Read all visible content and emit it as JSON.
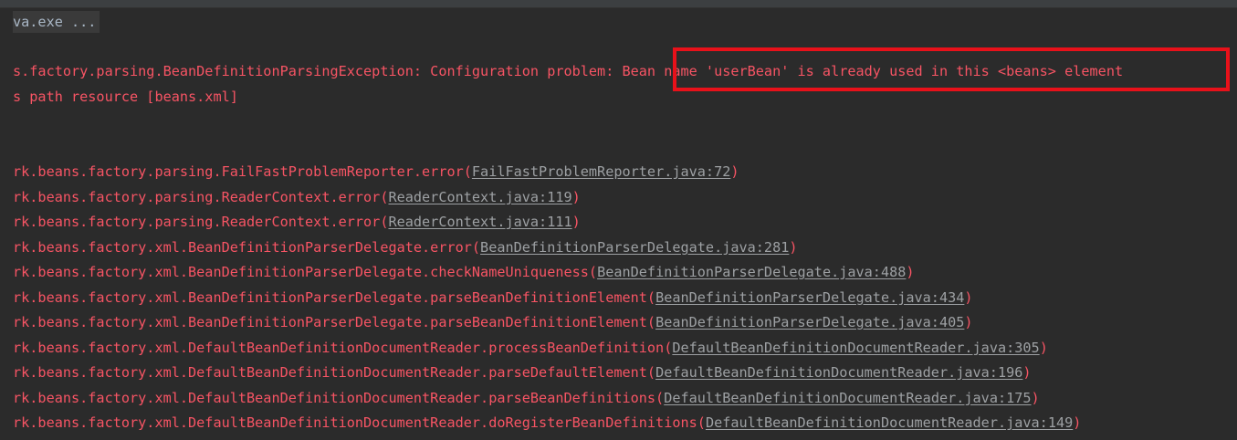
{
  "console": {
    "command_line": "va.exe ...",
    "exception_line": "s.factory.parsing.BeanDefinitionParsingException: Configuration problem: Bean name 'userBean' is already used in this <beans> element",
    "resource_line": "s path resource [beans.xml]",
    "stack_frames": [
      {
        "method": "rk.beans.factory.parsing.FailFastProblemReporter.error(",
        "link": "FailFastProblemReporter.java:72",
        "close": ")"
      },
      {
        "method": "rk.beans.factory.parsing.ReaderContext.error(",
        "link": "ReaderContext.java:119",
        "close": ")"
      },
      {
        "method": "rk.beans.factory.parsing.ReaderContext.error(",
        "link": "ReaderContext.java:111",
        "close": ")"
      },
      {
        "method": "rk.beans.factory.xml.BeanDefinitionParserDelegate.error(",
        "link": "BeanDefinitionParserDelegate.java:281",
        "close": ")"
      },
      {
        "method": "rk.beans.factory.xml.BeanDefinitionParserDelegate.checkNameUniqueness(",
        "link": "BeanDefinitionParserDelegate.java:488",
        "close": ")"
      },
      {
        "method": "rk.beans.factory.xml.BeanDefinitionParserDelegate.parseBeanDefinitionElement(",
        "link": "BeanDefinitionParserDelegate.java:434",
        "close": ")"
      },
      {
        "method": "rk.beans.factory.xml.BeanDefinitionParserDelegate.parseBeanDefinitionElement(",
        "link": "BeanDefinitionParserDelegate.java:405",
        "close": ")"
      },
      {
        "method": "rk.beans.factory.xml.DefaultBeanDefinitionDocumentReader.processBeanDefinition(",
        "link": "DefaultBeanDefinitionDocumentReader.java:305",
        "close": ")"
      },
      {
        "method": "rk.beans.factory.xml.DefaultBeanDefinitionDocumentReader.parseDefaultElement(",
        "link": "DefaultBeanDefinitionDocumentReader.java:196",
        "close": ")"
      },
      {
        "method": "rk.beans.factory.xml.DefaultBeanDefinitionDocumentReader.parseBeanDefinitions(",
        "link": "DefaultBeanDefinitionDocumentReader.java:175",
        "close": ")"
      },
      {
        "method": "rk.beans.factory.xml.DefaultBeanDefinitionDocumentReader.doRegisterBeanDefinitions(",
        "link": "DefaultBeanDefinitionDocumentReader.java:149",
        "close": ")"
      }
    ]
  },
  "colors": {
    "background": "#2b2b2b",
    "error_text": "#f75464",
    "link_text": "#9da0a3",
    "annotation_box": "#e8111a"
  }
}
